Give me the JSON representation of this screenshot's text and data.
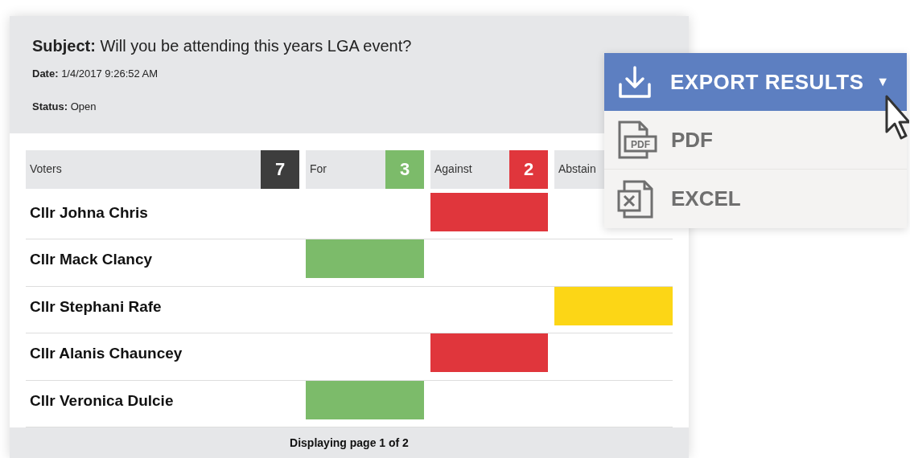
{
  "poll": {
    "subject_label": "Subject:",
    "subject": "Will you be attending this years LGA event?",
    "date_label": "Date:",
    "date": "1/4/2017 9:26:52 AM",
    "status_label": "Status:",
    "status": "Open"
  },
  "columns": [
    {
      "kind": "voters",
      "label": "Voters",
      "count": "7",
      "color": "#3d3d3d"
    },
    {
      "kind": "for",
      "label": "For",
      "count": "3",
      "color": "#7cbb6a"
    },
    {
      "kind": "against",
      "label": "Against",
      "count": "2",
      "color": "#e0363c"
    },
    {
      "kind": "abstain",
      "label": "Abstain",
      "color": "#fcd616"
    }
  ],
  "rows": [
    {
      "name": "Cllr Johna Chris",
      "kind": "against"
    },
    {
      "name": "Cllr Mack Clancy",
      "kind": "for"
    },
    {
      "name": "Cllr Stephani Rafe",
      "kind": "abstain"
    },
    {
      "name": "Cllr Alanis Chauncey",
      "kind": "against"
    },
    {
      "name": "Cllr Veronica Dulcie",
      "kind": "for"
    }
  ],
  "pager": "Displaying page 1 of 2",
  "export_menu": {
    "label": "EXPORT RESULTS",
    "caret": "▼",
    "expanded": true,
    "items": [
      {
        "kind": "pdf",
        "label": "PDF",
        "icon_text": "PDF"
      },
      {
        "kind": "excel",
        "label": "EXCEL"
      }
    ]
  }
}
